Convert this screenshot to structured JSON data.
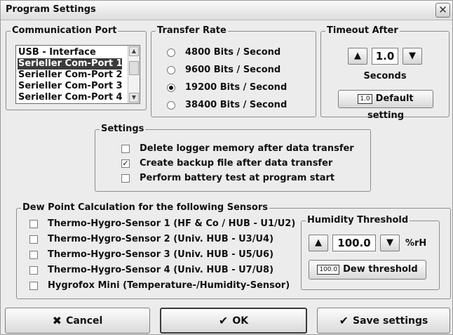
{
  "window": {
    "title": "Program Settings",
    "close_glyph": "✕"
  },
  "comm_port": {
    "legend": "Communication Port",
    "items": [
      "USB - Interface",
      "Serieller Com-Port 1",
      "Serieller Com-Port 2",
      "Serieller Com-Port 3",
      "Serieller Com-Port 4"
    ],
    "selected": "Serieller Com-Port 1"
  },
  "transfer_rate": {
    "legend": "Transfer Rate",
    "options": [
      "4800 Bits / Second",
      "9600 Bits / Second",
      "19200 Bits / Second",
      "38400 Bits / Second"
    ],
    "selected": "19200 Bits / Second"
  },
  "timeout": {
    "legend": "Timeout After",
    "value": "1.0",
    "unit": "Seconds",
    "default_badge": "1.0",
    "default_label": "Default setting"
  },
  "settings": {
    "legend": "Settings",
    "options": [
      {
        "label": "Delete logger memory after data transfer",
        "checked": false
      },
      {
        "label": "Create backup file after data transfer",
        "checked": true
      },
      {
        "label": "Perform battery test at program start",
        "checked": false
      }
    ]
  },
  "dew_point": {
    "legend": "Dew Point Calculation for the following Sensors",
    "sensors": [
      {
        "label": "Thermo-Hygro-Sensor 1 (HF & Co / HUB - U1/U2)",
        "checked": false
      },
      {
        "label": "Thermo-Hygro-Sensor 2 (Univ. HUB - U3/U4)",
        "checked": false
      },
      {
        "label": "Thermo-Hygro-Sensor 3 (Univ. HUB - U5/U6)",
        "checked": false
      },
      {
        "label": "Thermo-Hygro-Sensor 4 (Univ. HUB - U7/U8)",
        "checked": false
      },
      {
        "label": "Hygrofox Mini (Temperature-/Humidity-Sensor)",
        "checked": false
      }
    ]
  },
  "humidity": {
    "legend": "Humidity Threshold",
    "value": "100.0",
    "unit": "%rH",
    "badge": "100.0",
    "button_label": "Dew threshold"
  },
  "footer": {
    "cancel_icon": "✖",
    "cancel_label": "Cancel",
    "ok_icon": "✔",
    "ok_label": "OK",
    "save_icon": "✔",
    "save_label": "Save settings"
  },
  "icons": {
    "up": "▲",
    "down": "▼",
    "scroll_up": "▲",
    "scroll_down": "▼",
    "check": "✓"
  }
}
